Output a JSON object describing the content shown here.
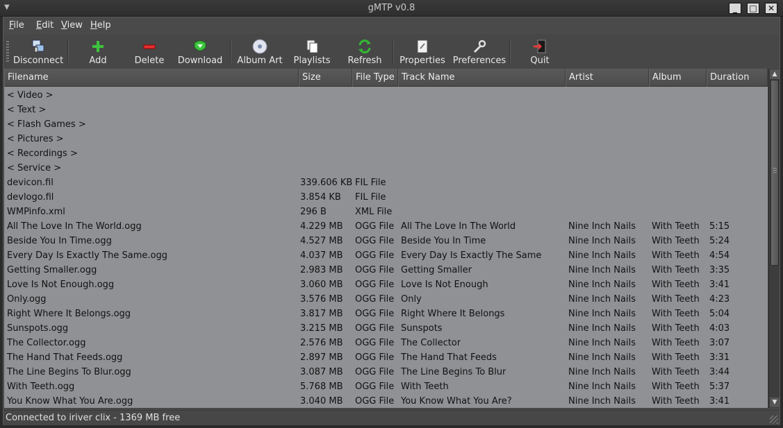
{
  "window": {
    "title": "gMTP v0.8"
  },
  "menu": [
    {
      "key": "file",
      "label": "File",
      "mnemonic": "F",
      "rest": "ile"
    },
    {
      "key": "edit",
      "label": "Edit",
      "mnemonic": "E",
      "rest": "dit"
    },
    {
      "key": "view",
      "label": "View",
      "mnemonic": "V",
      "rest": "iew"
    },
    {
      "key": "help",
      "label": "Help",
      "mnemonic": "H",
      "rest": "elp"
    }
  ],
  "toolbar": {
    "disconnect": "Disconnect",
    "add": "Add",
    "delete": "Delete",
    "download": "Download",
    "album_art": "Album Art",
    "playlists": "Playlists",
    "refresh": "Refresh",
    "properties": "Properties",
    "preferences": "Preferences",
    "quit": "Quit"
  },
  "columns": [
    "Filename",
    "Size",
    "File Type",
    "Track Name",
    "Artist",
    "Album",
    "Duration"
  ],
  "rows": [
    [
      "< Video >",
      "",
      "",
      "",
      "",
      "",
      ""
    ],
    [
      "< Text >",
      "",
      "",
      "",
      "",
      "",
      ""
    ],
    [
      "< Flash Games >",
      "",
      "",
      "",
      "",
      "",
      ""
    ],
    [
      "< Pictures >",
      "",
      "",
      "",
      "",
      "",
      ""
    ],
    [
      "< Recordings >",
      "",
      "",
      "",
      "",
      "",
      ""
    ],
    [
      "< Service >",
      "",
      "",
      "",
      "",
      "",
      ""
    ],
    [
      "devicon.fil",
      "339.606 KB",
      "FIL File",
      "",
      "",
      "",
      ""
    ],
    [
      "devlogo.fil",
      "3.854 KB",
      "FIL File",
      "",
      "",
      "",
      ""
    ],
    [
      "WMPinfo.xml",
      "296 B",
      "XML File",
      "",
      "",
      "",
      ""
    ],
    [
      "All The Love In The World.ogg",
      "4.229 MB",
      "OGG File",
      "All The Love In The World",
      "Nine Inch Nails",
      "With Teeth",
      "5:15"
    ],
    [
      "Beside You In Time.ogg",
      "4.527 MB",
      "OGG File",
      "Beside You In Time",
      "Nine Inch Nails",
      "With Teeth",
      "5:24"
    ],
    [
      "Every Day Is Exactly The Same.ogg",
      "4.037 MB",
      "OGG File",
      "Every Day Is Exactly The Same",
      "Nine Inch Nails",
      "With Teeth",
      "4:54"
    ],
    [
      "Getting Smaller.ogg",
      "2.983 MB",
      "OGG File",
      "Getting Smaller",
      "Nine Inch Nails",
      "With Teeth",
      "3:35"
    ],
    [
      "Love Is Not Enough.ogg",
      "3.060 MB",
      "OGG File",
      "Love Is Not Enough",
      "Nine Inch Nails",
      "With Teeth",
      "3:41"
    ],
    [
      "Only.ogg",
      "3.576 MB",
      "OGG File",
      "Only",
      "Nine Inch Nails",
      "With Teeth",
      "4:23"
    ],
    [
      "Right Where It Belongs.ogg",
      "3.817 MB",
      "OGG File",
      "Right Where It Belongs",
      "Nine Inch Nails",
      "With Teeth",
      "5:04"
    ],
    [
      "Sunspots.ogg",
      "3.215 MB",
      "OGG File",
      "Sunspots",
      "Nine Inch Nails",
      "With Teeth",
      "4:03"
    ],
    [
      "The Collector.ogg",
      "2.576 MB",
      "OGG File",
      "The Collector",
      "Nine Inch Nails",
      "With Teeth",
      "3:07"
    ],
    [
      "The Hand That Feeds.ogg",
      "2.897 MB",
      "OGG File",
      "The Hand That Feeds",
      "Nine Inch Nails",
      "With Teeth",
      "3:31"
    ],
    [
      "The Line Begins To Blur.ogg",
      "3.087 MB",
      "OGG File",
      "The Line Begins To Blur",
      "Nine Inch Nails",
      "With Teeth",
      "3:44"
    ],
    [
      "With Teeth.ogg",
      "5.768 MB",
      "OGG File",
      "With Teeth",
      "Nine Inch Nails",
      "With Teeth",
      "5:37"
    ],
    [
      "You Know What You Are.ogg",
      "3.040 MB",
      "OGG File",
      "You Know What You Are?",
      "Nine Inch Nails",
      "With Teeth",
      "3:41"
    ]
  ],
  "status": {
    "text": "Connected to iriver clix - 1369 MB free"
  }
}
